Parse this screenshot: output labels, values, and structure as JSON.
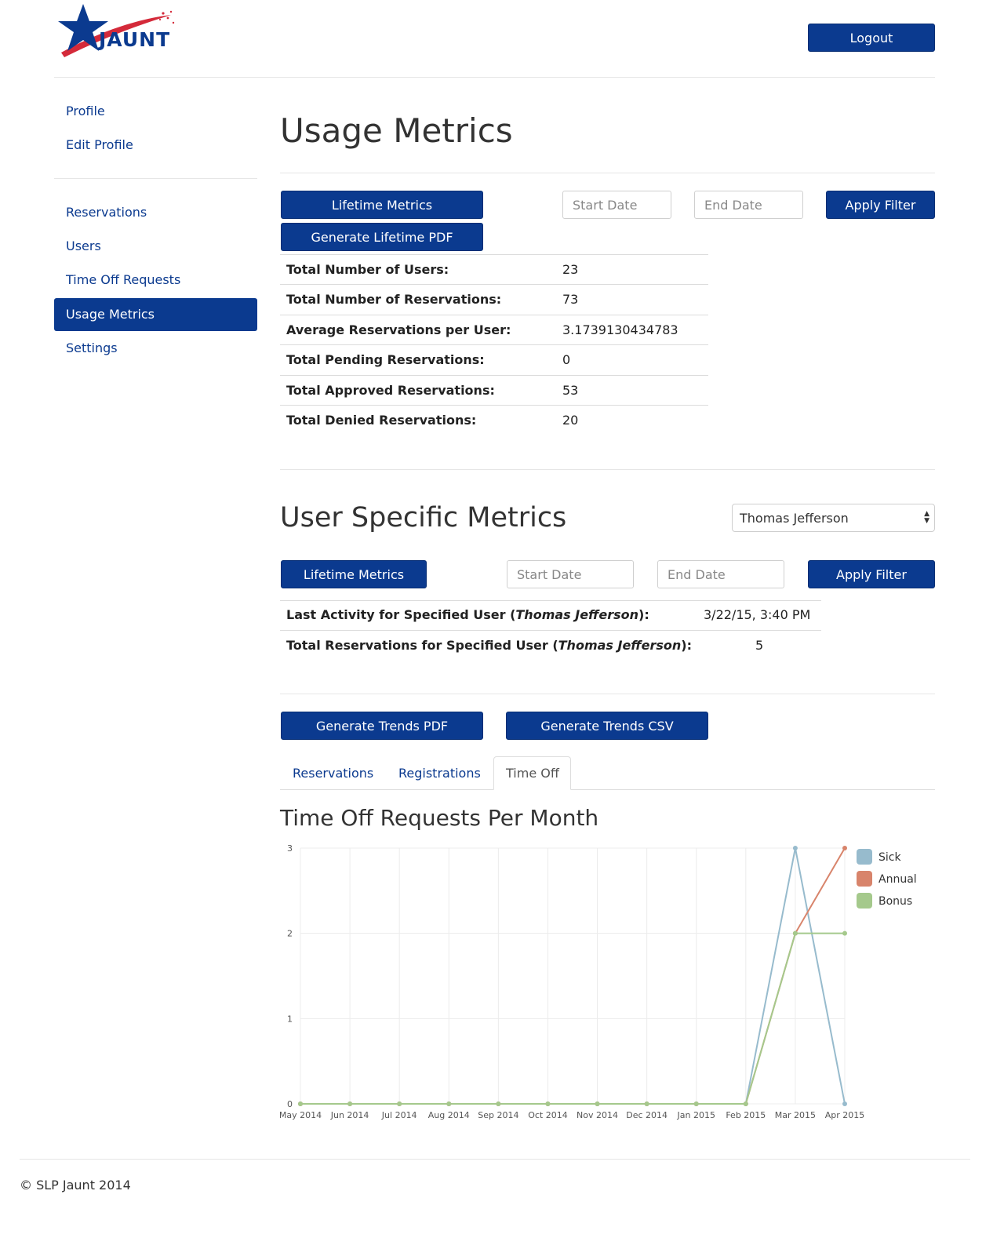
{
  "brand": {
    "logo_text": "JAUNT"
  },
  "header": {
    "logout_label": "Logout"
  },
  "sidebar": {
    "items": [
      {
        "label": "Profile"
      },
      {
        "label": "Edit Profile"
      },
      {
        "label": "Reservations"
      },
      {
        "label": "Users"
      },
      {
        "label": "Time Off Requests"
      },
      {
        "label": "Usage Metrics",
        "active": true
      },
      {
        "label": "Settings"
      }
    ]
  },
  "usage": {
    "title": "Usage Metrics",
    "lifetime_label": "Lifetime Metrics",
    "pdf_label": "Generate Lifetime PDF",
    "start_placeholder": "Start Date",
    "end_placeholder": "End Date",
    "apply_label": "Apply Filter",
    "rows": [
      {
        "label": "Total Number of Users:",
        "value": "23"
      },
      {
        "label": "Total Number of Reservations:",
        "value": "73"
      },
      {
        "label": "Average Reservations per User:",
        "value": "3.1739130434783"
      },
      {
        "label": "Total Pending Reservations:",
        "value": "0"
      },
      {
        "label": "Total Approved Reservations:",
        "value": "53"
      },
      {
        "label": "Total Denied Reservations:",
        "value": "20"
      }
    ]
  },
  "user_metrics": {
    "title": "User Specific Metrics",
    "selected_user": "Thomas Jefferson",
    "lifetime_label": "Lifetime Metrics",
    "start_placeholder": "Start Date",
    "end_placeholder": "End Date",
    "apply_label": "Apply Filter",
    "last_activity_prefix": "Last Activity for Specified User (",
    "last_activity_user": "Thomas Jefferson",
    "last_activity_suffix": "):",
    "last_activity_value": "3/22/15, 3:40 PM",
    "total_prefix": "Total Reservations for Specified User (",
    "total_user": "Thomas Jefferson",
    "total_suffix": "):",
    "total_value": "5"
  },
  "trends": {
    "pdf_label": "Generate Trends PDF",
    "csv_label": "Generate Trends CSV",
    "tabs": [
      {
        "label": "Reservations"
      },
      {
        "label": "Registrations"
      },
      {
        "label": "Time Off",
        "active": true
      }
    ],
    "chart_title": "Time Off Requests Per Month"
  },
  "chart_data": {
    "type": "line",
    "title": "Time Off Requests Per Month",
    "categories": [
      "May 2014",
      "Jun 2014",
      "Jul 2014",
      "Aug 2014",
      "Sep 2014",
      "Oct 2014",
      "Nov 2014",
      "Dec 2014",
      "Jan 2015",
      "Feb 2015",
      "Mar 2015",
      "Apr 2015"
    ],
    "ylim": [
      0,
      3
    ],
    "yticks": [
      "0",
      "1",
      "2",
      "3"
    ],
    "grid": true,
    "legend": "right",
    "series": [
      {
        "name": "Sick",
        "color": "#97bbcd",
        "values": [
          0,
          0,
          0,
          0,
          0,
          0,
          0,
          0,
          0,
          0,
          3,
          0
        ]
      },
      {
        "name": "Annual",
        "color": "#d8846b",
        "values": [
          0,
          0,
          0,
          0,
          0,
          0,
          0,
          0,
          0,
          0,
          2,
          3
        ]
      },
      {
        "name": "Bonus",
        "color": "#a5c98c",
        "values": [
          0,
          0,
          0,
          0,
          0,
          0,
          0,
          0,
          0,
          0,
          2,
          2
        ]
      }
    ]
  },
  "footer": {
    "text": "© SLP Jaunt 2014"
  },
  "colors": {
    "primary": "#0b3a8f",
    "logo_red": "#d42a3a"
  }
}
